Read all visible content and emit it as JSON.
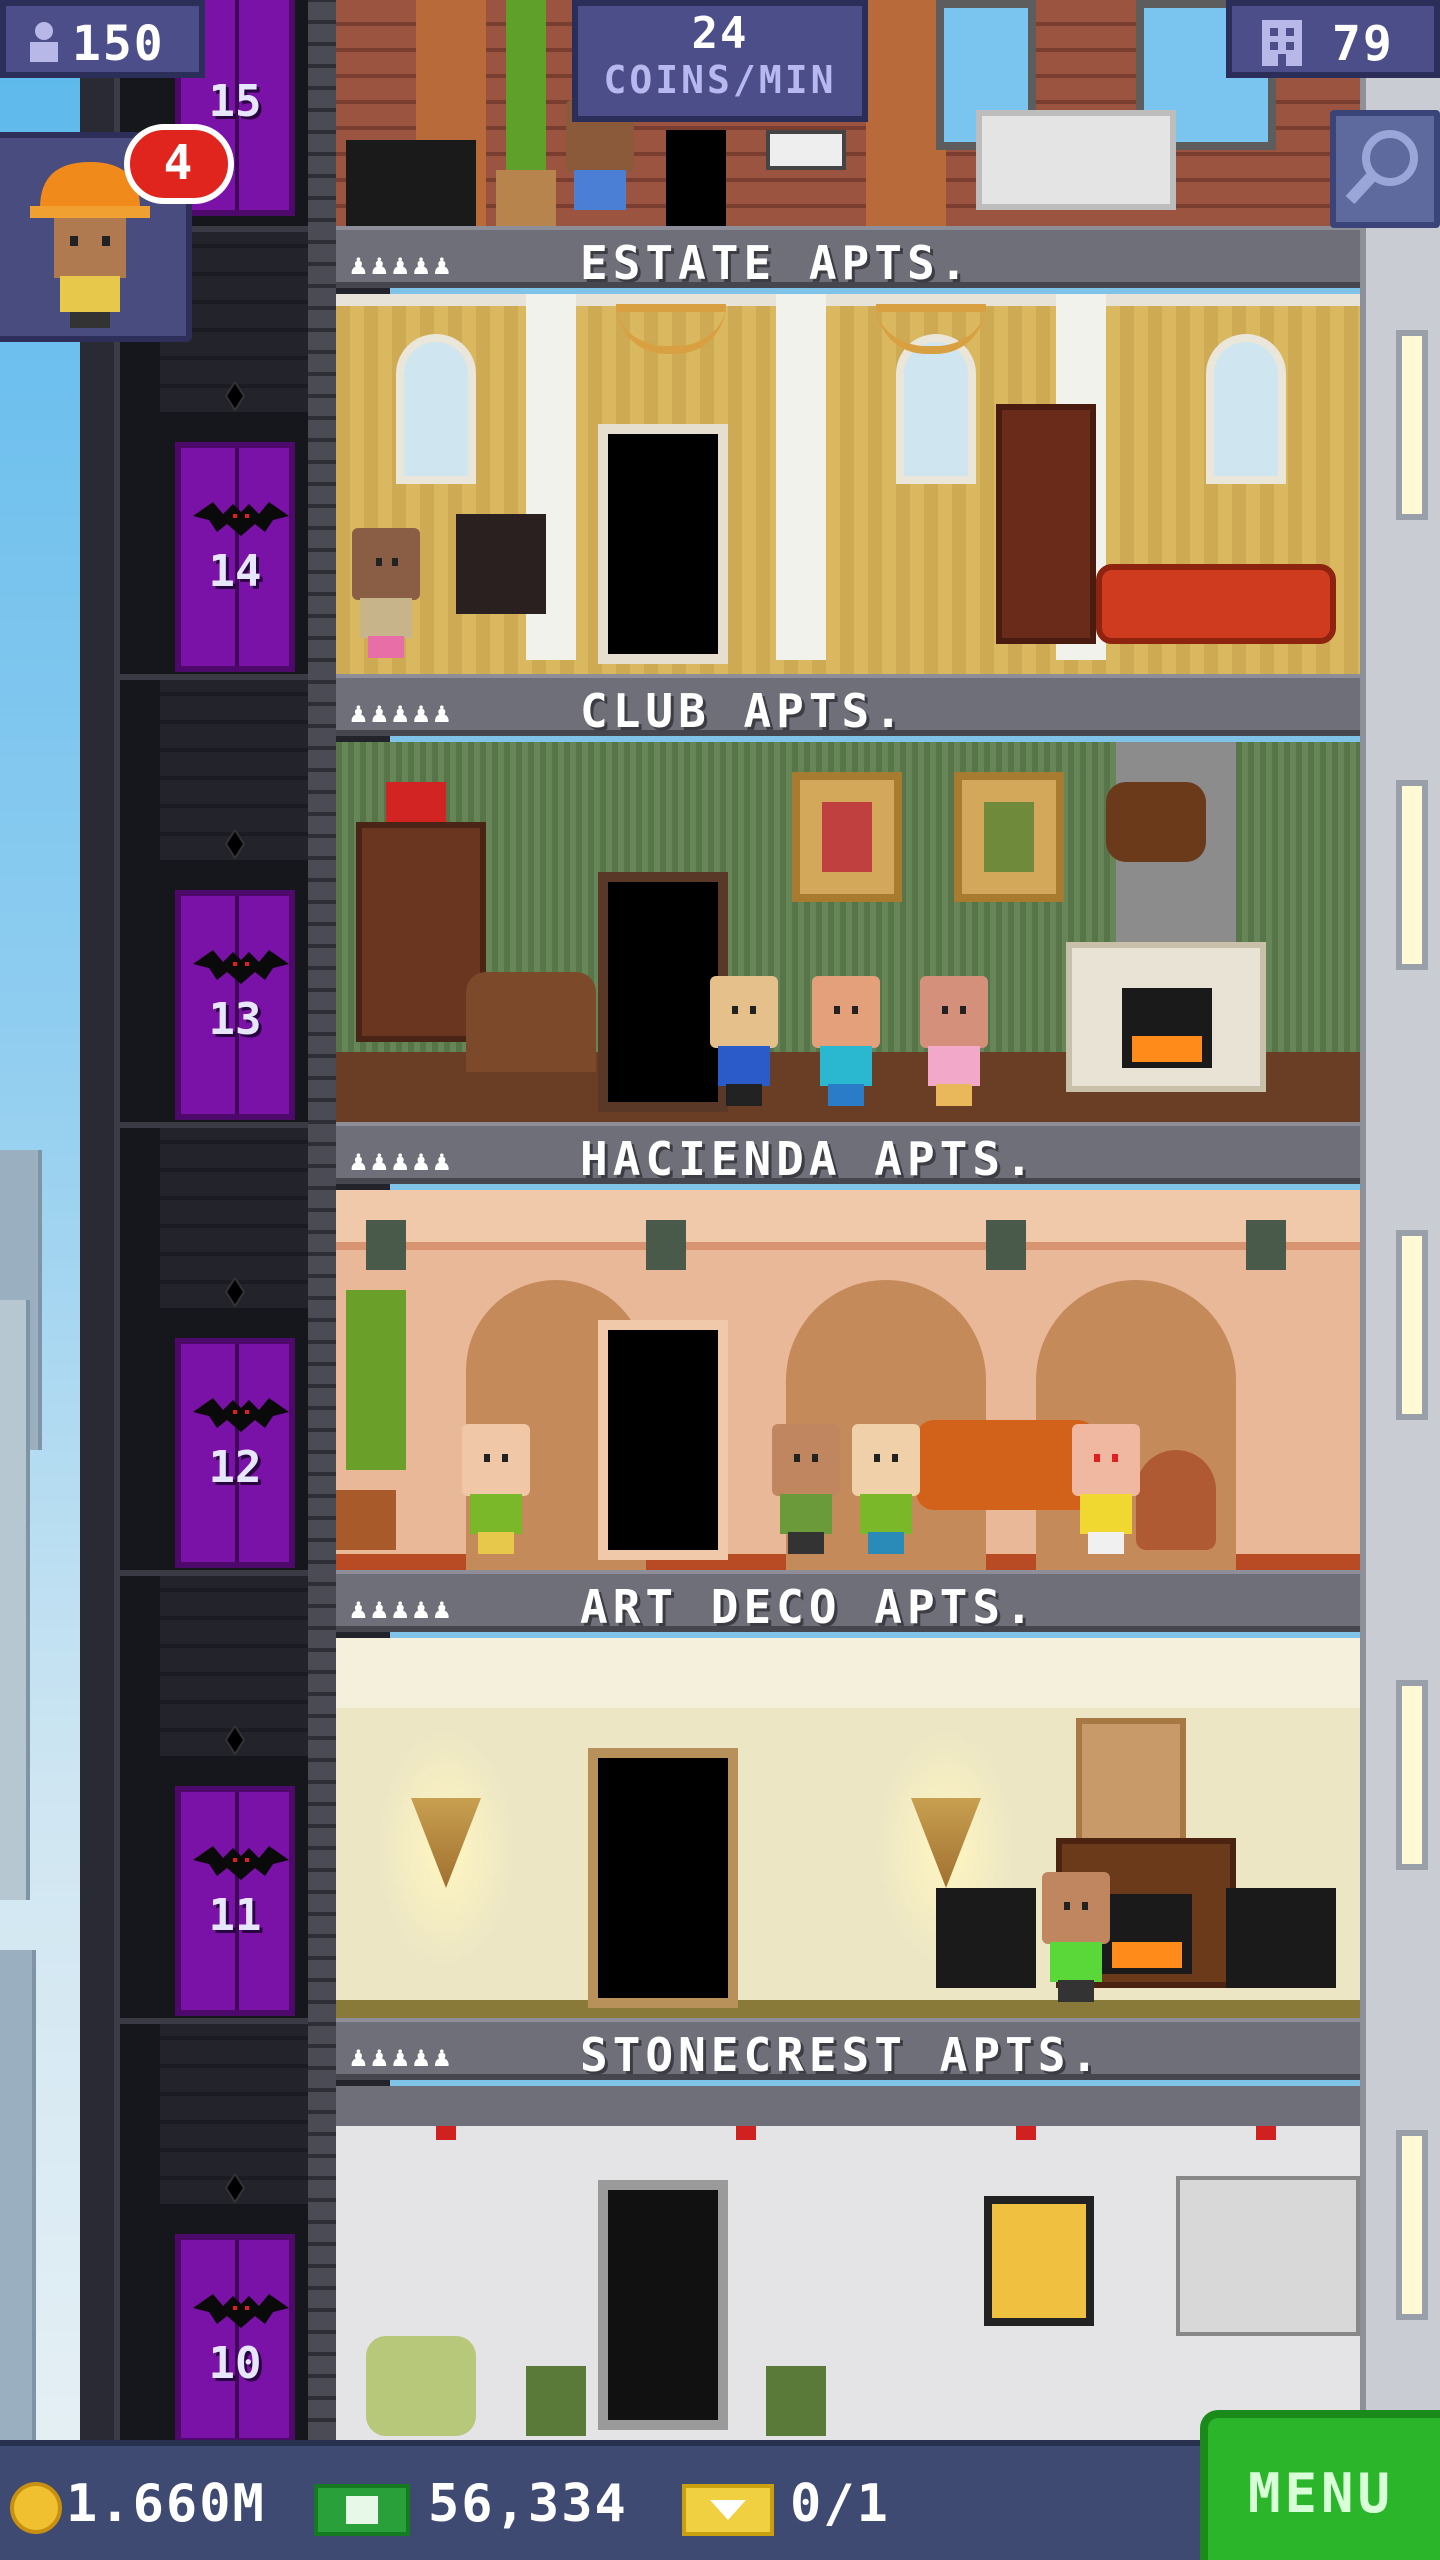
{
  "hud": {
    "population": "150",
    "coins_per_min_value": "24",
    "coins_per_min_label": "COINS/MIN",
    "floors": "79",
    "worker_badge": "4"
  },
  "floors": [
    {
      "number": "14",
      "name": "ESTATE APTS.",
      "residents_icons": "♟♟♟♟♟"
    },
    {
      "number": "13",
      "name": "CLUB APTS.",
      "residents_icons": "♟♟♟♟♟"
    },
    {
      "number": "12",
      "name": "HACIENDA APTS.",
      "residents_icons": "♟♟♟♟♟"
    },
    {
      "number": "11",
      "name": "ART DECO APTS.",
      "residents_icons": "♟♟♟♟♟"
    },
    {
      "number": "10",
      "name": "STONECREST APTS.",
      "residents_icons": "♟♟♟♟♟"
    }
  ],
  "top_floor_number": "15",
  "bottombar": {
    "coins": "1.660M",
    "bux": "56,334",
    "tickets": "0/1",
    "menu_label": "MENU"
  },
  "colors": {
    "elevator_door": "#7a12a8",
    "hud_bg": "#4b4e88",
    "menu_green": "#2bb52b"
  },
  "icons": {
    "population": "person-icon",
    "floors": "building-icon",
    "zoom": "magnifier-icon",
    "coins": "coin-icon",
    "bux": "bux-icon",
    "tickets": "ticket-icon"
  }
}
